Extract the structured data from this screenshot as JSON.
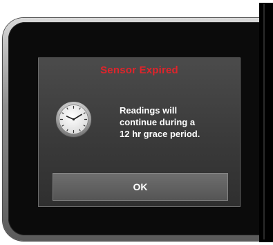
{
  "dialog": {
    "title": "Sensor Expired",
    "message": "Readings will\ncontinue during a\n12 hr grace period.",
    "icon": "clock-icon",
    "ok_label": "OK"
  },
  "colors": {
    "title": "#e0242b",
    "dialog_background": "#3f3f3f",
    "button_background": "#606060",
    "screen_background": "#0b0b0b"
  }
}
